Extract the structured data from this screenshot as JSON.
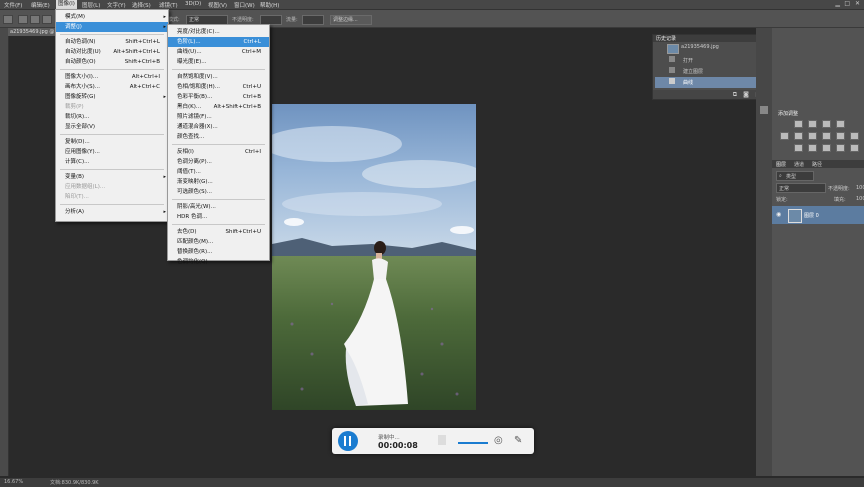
{
  "menubar": {
    "items": [
      "文件(F)",
      "编辑(E)",
      "图像(I)",
      "图层(L)",
      "文字(Y)",
      "选择(S)",
      "滤镜(T)",
      "3D(D)",
      "视图(V)",
      "窗口(W)",
      "帮助(H)"
    ],
    "active_index": 2
  },
  "options": {
    "mode_label": "模式:",
    "mode_value": "正常",
    "opacity_label": "不透明度:",
    "flow_label": "流量:",
    "refine_button": "调整边缘..."
  },
  "document": {
    "tab_title": "a21935469.jpg @ ...",
    "filename": "a21935469.jpg"
  },
  "image_menu": {
    "items": [
      {
        "label": "模式(M)",
        "shortcut": "",
        "submenu": true,
        "disabled": false,
        "highlighted": false
      },
      {
        "label": "调整(J)",
        "shortcut": "",
        "submenu": true,
        "disabled": false,
        "highlighted": true
      },
      {
        "label": "自动色调(N)",
        "shortcut": "Shift+Ctrl+L",
        "submenu": false,
        "disabled": false,
        "highlighted": false
      },
      {
        "label": "自动对比度(U)",
        "shortcut": "Alt+Shift+Ctrl+L",
        "submenu": false,
        "disabled": false,
        "highlighted": false
      },
      {
        "label": "自动颜色(O)",
        "shortcut": "Shift+Ctrl+B",
        "submenu": false,
        "disabled": false,
        "highlighted": false
      },
      {
        "label": "图像大小(I)...",
        "shortcut": "Alt+Ctrl+I",
        "submenu": false,
        "disabled": false,
        "highlighted": false
      },
      {
        "label": "画布大小(S)...",
        "shortcut": "Alt+Ctrl+C",
        "submenu": false,
        "disabled": false,
        "highlighted": false
      },
      {
        "label": "图像旋转(G)",
        "shortcut": "",
        "submenu": true,
        "disabled": false,
        "highlighted": false
      },
      {
        "label": "裁剪(P)",
        "shortcut": "",
        "submenu": false,
        "disabled": true,
        "highlighted": false
      },
      {
        "label": "裁切(R)...",
        "shortcut": "",
        "submenu": false,
        "disabled": false,
        "highlighted": false
      },
      {
        "label": "显示全部(V)",
        "shortcut": "",
        "submenu": false,
        "disabled": false,
        "highlighted": false
      },
      {
        "label": "复制(D)...",
        "shortcut": "",
        "submenu": false,
        "disabled": false,
        "highlighted": false
      },
      {
        "label": "应用图像(Y)...",
        "shortcut": "",
        "submenu": false,
        "disabled": false,
        "highlighted": false
      },
      {
        "label": "计算(C)...",
        "shortcut": "",
        "submenu": false,
        "disabled": false,
        "highlighted": false
      },
      {
        "label": "变量(B)",
        "shortcut": "",
        "submenu": true,
        "disabled": false,
        "highlighted": false
      },
      {
        "label": "应用数据组(L)...",
        "shortcut": "",
        "submenu": false,
        "disabled": true,
        "highlighted": false
      },
      {
        "label": "陷印(T)...",
        "shortcut": "",
        "submenu": false,
        "disabled": true,
        "highlighted": false
      },
      {
        "label": "分析(A)",
        "shortcut": "",
        "submenu": true,
        "disabled": false,
        "highlighted": false
      }
    ]
  },
  "adjust_menu": {
    "items": [
      {
        "label": "亮度/对比度(C)...",
        "shortcut": "",
        "highlighted": false
      },
      {
        "label": "色阶(L)...",
        "shortcut": "Ctrl+L",
        "highlighted": true
      },
      {
        "label": "曲线(U)...",
        "shortcut": "Ctrl+M",
        "highlighted": false
      },
      {
        "label": "曝光度(E)...",
        "shortcut": "",
        "highlighted": false
      },
      {
        "label": "自然饱和度(V)...",
        "shortcut": "",
        "highlighted": false
      },
      {
        "label": "色相/饱和度(H)...",
        "shortcut": "Ctrl+U",
        "highlighted": false
      },
      {
        "label": "色彩平衡(B)...",
        "shortcut": "Ctrl+B",
        "highlighted": false
      },
      {
        "label": "黑白(K)...",
        "shortcut": "Alt+Shift+Ctrl+B",
        "highlighted": false
      },
      {
        "label": "照片滤镜(F)...",
        "shortcut": "",
        "highlighted": false
      },
      {
        "label": "通道混合器(X)...",
        "shortcut": "",
        "highlighted": false
      },
      {
        "label": "颜色查找...",
        "shortcut": "",
        "highlighted": false
      },
      {
        "label": "反相(I)",
        "shortcut": "Ctrl+I",
        "highlighted": false
      },
      {
        "label": "色调分离(P)...",
        "shortcut": "",
        "highlighted": false
      },
      {
        "label": "阈值(T)...",
        "shortcut": "",
        "highlighted": false
      },
      {
        "label": "渐变映射(G)...",
        "shortcut": "",
        "highlighted": false
      },
      {
        "label": "可选颜色(S)...",
        "shortcut": "",
        "highlighted": false
      },
      {
        "label": "阴影/高光(W)...",
        "shortcut": "",
        "highlighted": false
      },
      {
        "label": "HDR 色调...",
        "shortcut": "",
        "highlighted": false
      },
      {
        "label": "去色(D)",
        "shortcut": "Shift+Ctrl+U",
        "highlighted": false
      },
      {
        "label": "匹配颜色(M)...",
        "shortcut": "",
        "highlighted": false
      },
      {
        "label": "替换颜色(R)...",
        "shortcut": "",
        "highlighted": false
      },
      {
        "label": "色调均化(Q)",
        "shortcut": "",
        "highlighted": false
      }
    ]
  },
  "history": {
    "tab": "历史记录",
    "snapshot": "a21935469.jpg",
    "steps": [
      "打开",
      "建立图层",
      "曲线"
    ],
    "selected_index": 2
  },
  "adjustments": {
    "title": "添加调整"
  },
  "layers": {
    "tabs": [
      "图层",
      "通道",
      "路径"
    ],
    "filter_value": "类型",
    "blend_mode": "正常",
    "opacity_label": "不透明度:",
    "opacity_value": "100",
    "lock_label": "锁定:",
    "fill_label": "填充:",
    "fill_value": "100",
    "layer_name": "图层 0"
  },
  "status": {
    "zoom": "16.67%",
    "doc_info": "文档:830.9K/830.9K"
  },
  "recorder": {
    "status": "录制中...",
    "time": "00:00:08"
  },
  "colors": {
    "menu_highlight": "#3a8fd8",
    "panel": "#535353",
    "recorder_accent": "#1a7cd0"
  }
}
